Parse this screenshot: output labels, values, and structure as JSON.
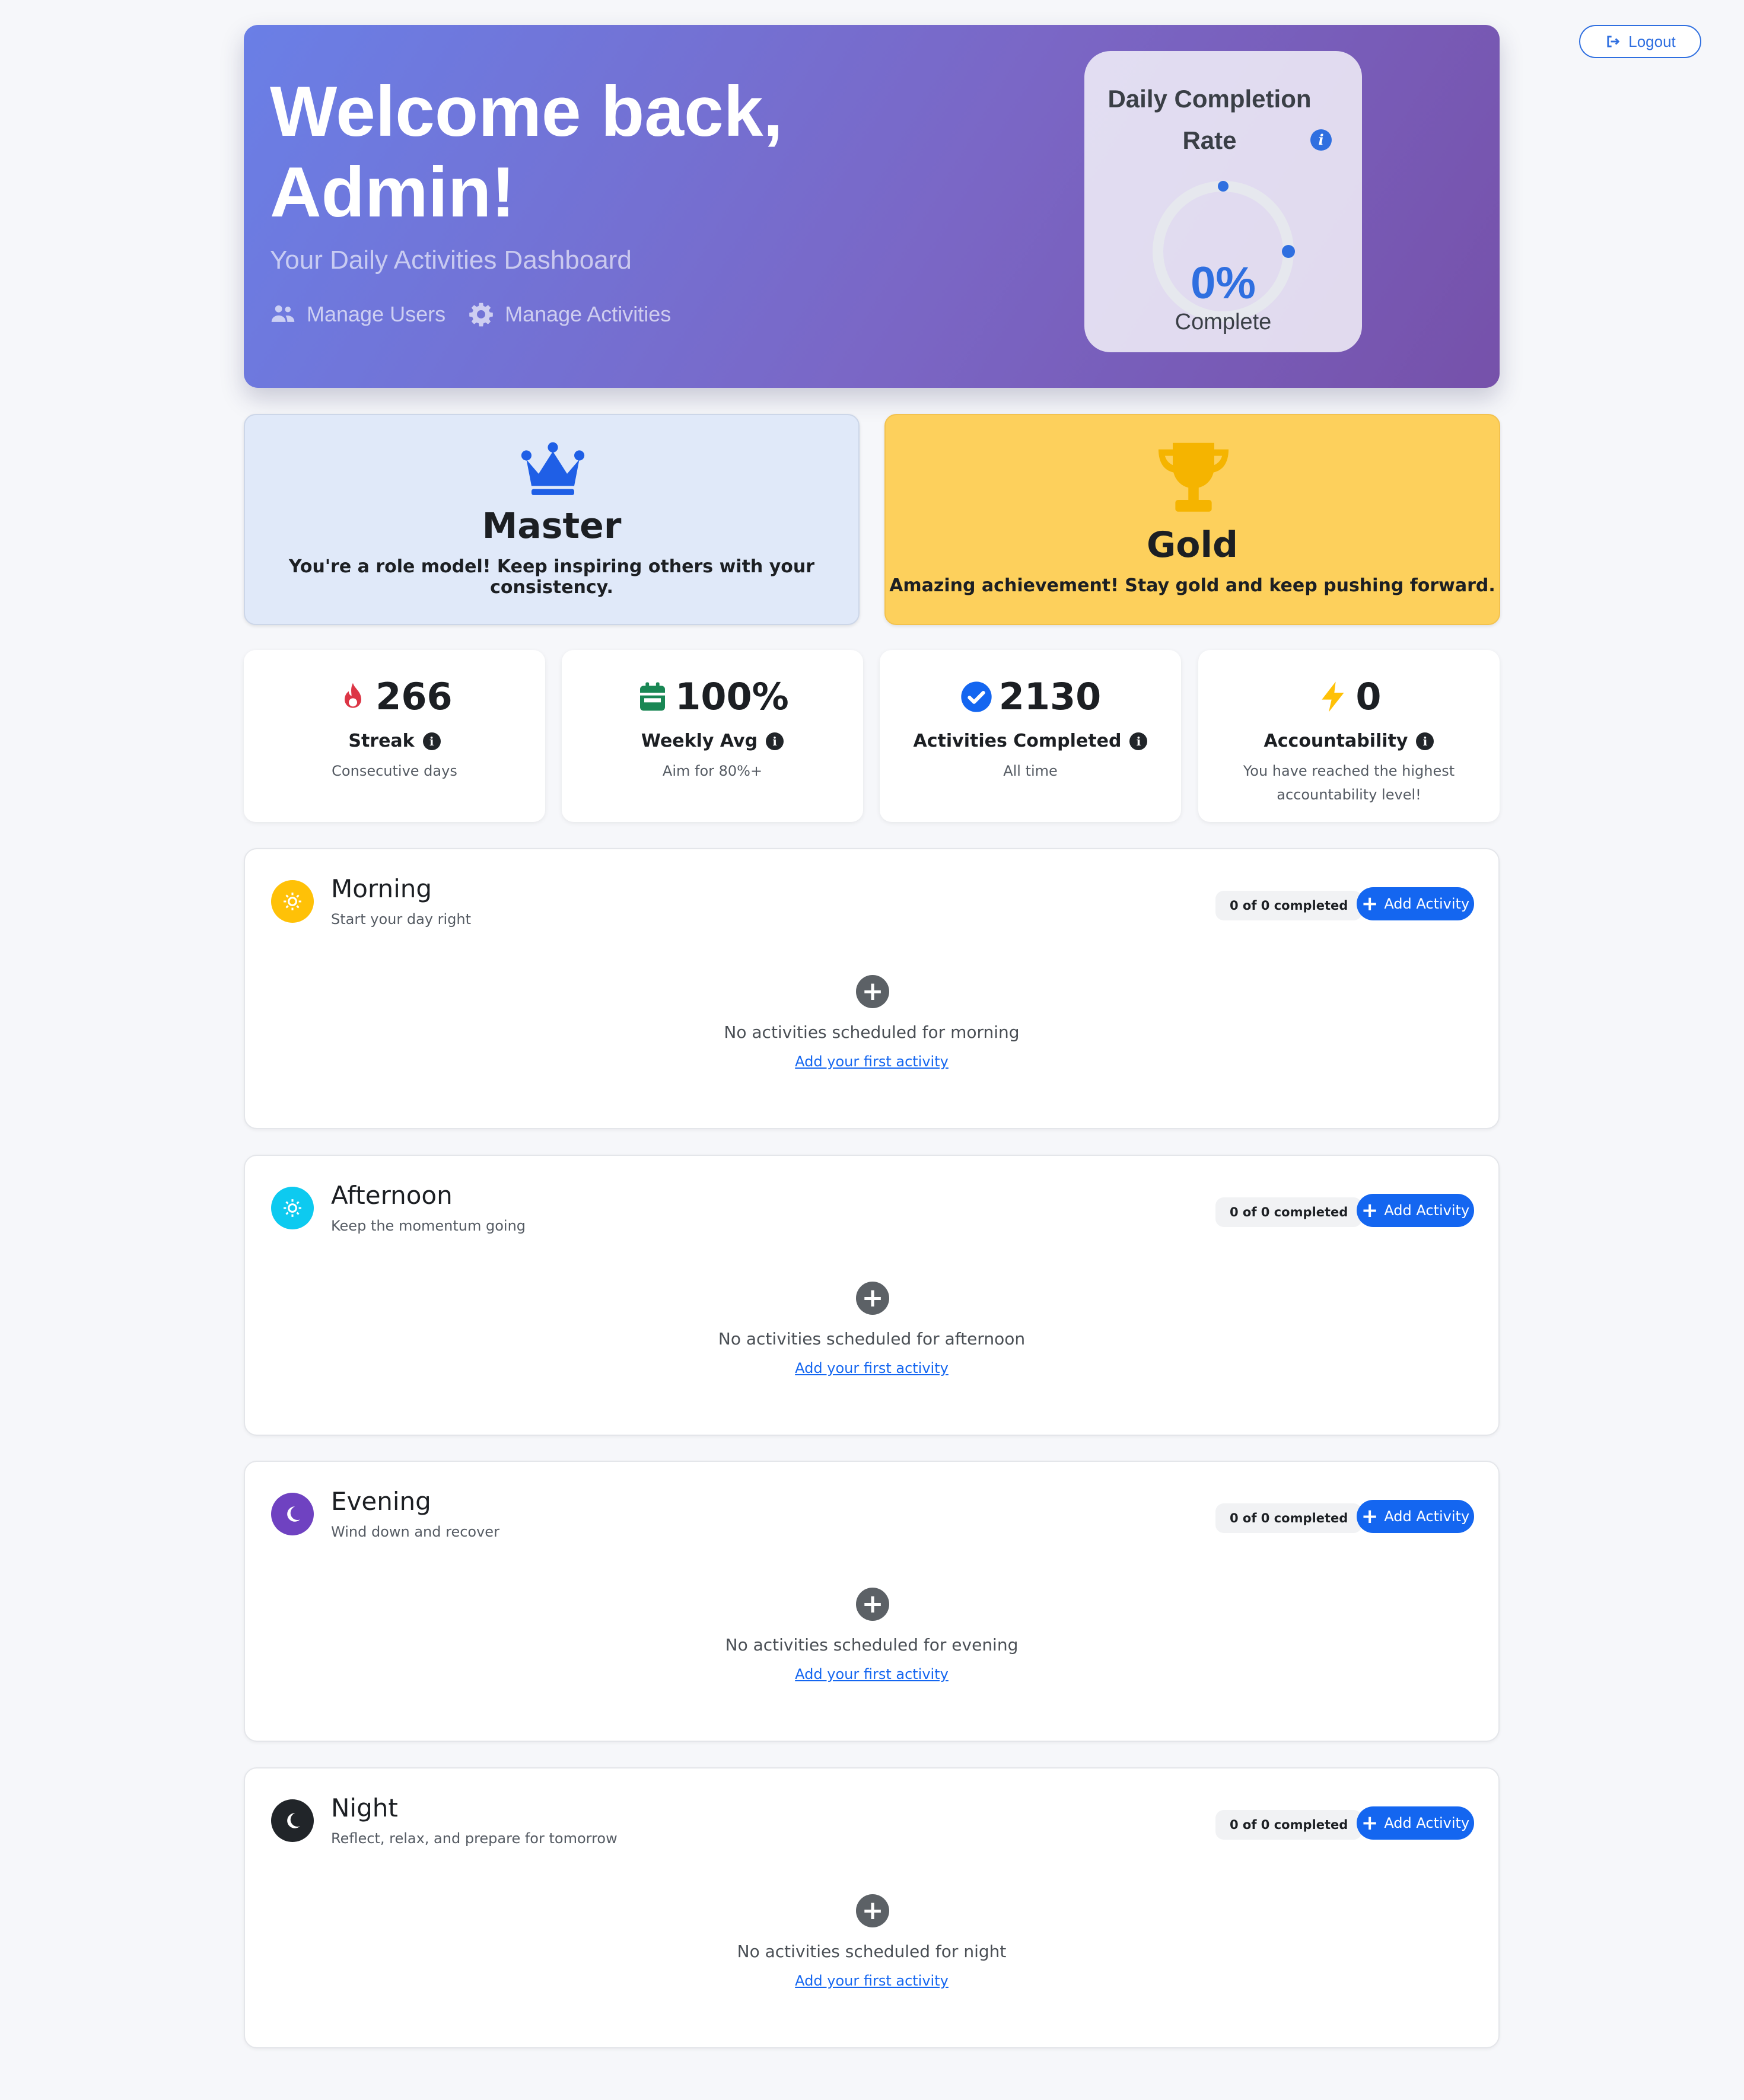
{
  "header": {
    "logout_label": "Logout",
    "welcome_title": "Welcome back, Admin!",
    "subtitle": "Your Daily Activities Dashboard",
    "links": [
      {
        "label": "Manage Users",
        "icon": "users-icon"
      },
      {
        "label": "Manage Activities",
        "icon": "gear-icon"
      }
    ]
  },
  "completion": {
    "title": "Daily Completion Rate",
    "info_icon": "info-icon",
    "value": "0%",
    "label": "Complete",
    "progress_fraction": 0
  },
  "badges": [
    {
      "title": "Master",
      "description": "You're a role model! Keep inspiring others with your consistency.",
      "icon": "crown-icon"
    },
    {
      "title": "Gold",
      "description": "Amazing achievement! Stay gold and keep pushing forward.",
      "icon": "trophy-icon"
    }
  ],
  "stats": [
    {
      "value": "266",
      "label": "Streak",
      "sub": "Consecutive days",
      "icon": "fire-icon",
      "color": "#dc3545"
    },
    {
      "value": "100%",
      "label": "Weekly Avg",
      "sub": "Aim for 80%+",
      "icon": "calendar-icon",
      "color": "#198754"
    },
    {
      "value": "2130",
      "label": "Activities Completed",
      "sub": "All time",
      "icon": "check-circle-icon",
      "color": "#1466f0"
    },
    {
      "value": "0",
      "label": "Accountability",
      "sub": "You have reached the highest accountability level!",
      "icon": "bolt-icon",
      "color": "#ffc107"
    }
  ],
  "sections": [
    {
      "title": "Morning",
      "subtitle": "Start your day right",
      "count": "0 of 0 completed",
      "add_label": "Add Activity",
      "empty_text": "No activities scheduled for morning",
      "empty_link": "Add your first activity",
      "icon": "sun-icon",
      "color": "#ffc107"
    },
    {
      "title": "Afternoon",
      "subtitle": "Keep the momentum going",
      "count": "0 of 0 completed",
      "add_label": "Add Activity",
      "empty_text": "No activities scheduled for afternoon",
      "empty_link": "Add your first activity",
      "icon": "sun-icon",
      "color": "#0dcaf0"
    },
    {
      "title": "Evening",
      "subtitle": "Wind down and recover",
      "count": "0 of 0 completed",
      "add_label": "Add Activity",
      "empty_text": "No activities scheduled for evening",
      "empty_link": "Add your first activity",
      "icon": "moon-icon",
      "color": "#6f42c1"
    },
    {
      "title": "Night",
      "subtitle": "Reflect, relax, and prepare for tomorrow",
      "count": "0 of 0 completed",
      "add_label": "Add Activity",
      "empty_text": "No activities scheduled for night",
      "empty_link": "Add your first activity",
      "icon": "moon-icon",
      "color": "#212529"
    }
  ]
}
